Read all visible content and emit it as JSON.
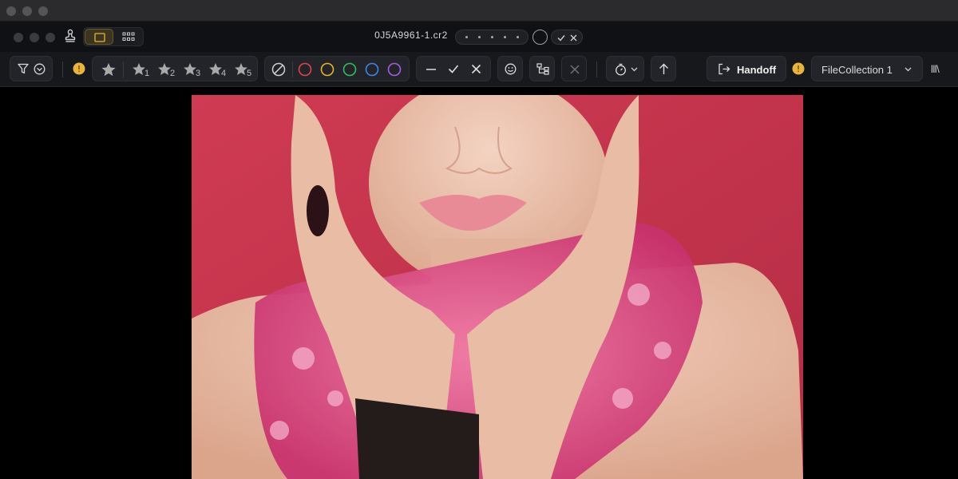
{
  "window": {
    "filename": "0J5A9961-1.cr2"
  },
  "toolbar": {
    "stars": [
      {
        "number": "1"
      },
      {
        "number": "2"
      },
      {
        "number": "3"
      },
      {
        "number": "4"
      },
      {
        "number": "5"
      }
    ],
    "color_labels": [
      "#e0444a",
      "#e8b520",
      "#2fbf5a",
      "#3a86ef",
      "#a65ce0"
    ],
    "handoff_label": "Handoff",
    "collection": {
      "selected": "FileCollection 1"
    },
    "library_glyph": "lll\\"
  },
  "colors": {
    "accent": "#e8b53a",
    "backdrop": "#c9384f"
  }
}
